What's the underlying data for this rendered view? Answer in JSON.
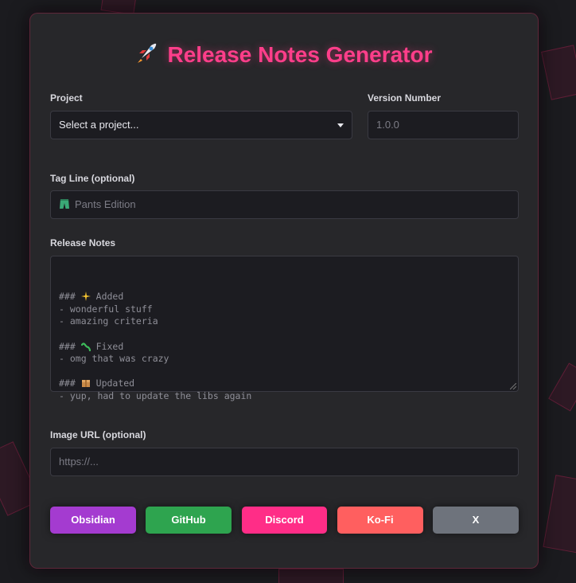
{
  "app": {
    "title": "Release Notes Generator",
    "accent_color": "#ff3e8a",
    "title_icon": "rocket-icon"
  },
  "form": {
    "project": {
      "label": "Project",
      "selected": "Select a project..."
    },
    "version": {
      "label": "Version Number",
      "placeholder": "1.0.0"
    },
    "tagline": {
      "label": "Tag Line (optional)",
      "placeholder_icon": "pants-icon",
      "placeholder": "Pants Edition"
    },
    "release_notes": {
      "label": "Release Notes",
      "lines": [
        {
          "prefix": "### ",
          "icon": "sparkles-icon",
          "text": "Added"
        },
        {
          "prefix": "",
          "icon": null,
          "text": "- wonderful stuff"
        },
        {
          "prefix": "",
          "icon": null,
          "text": "- amazing criteria"
        },
        {
          "prefix": "",
          "icon": null,
          "text": ""
        },
        {
          "prefix": "### ",
          "icon": "worm-icon",
          "text": "Fixed"
        },
        {
          "prefix": "",
          "icon": null,
          "text": "- omg that was crazy"
        },
        {
          "prefix": "",
          "icon": null,
          "text": ""
        },
        {
          "prefix": "### ",
          "icon": "package-icon",
          "text": "Updated"
        },
        {
          "prefix": "",
          "icon": null,
          "text": "- yup, had to update the libs again"
        }
      ]
    },
    "image_url": {
      "label": "Image URL (optional)",
      "placeholder": "https://..."
    }
  },
  "buttons": [
    {
      "label": "Obsidian",
      "color": "#a43bd0"
    },
    {
      "label": "GitHub",
      "color": "#2ea44f"
    },
    {
      "label": "Discord",
      "color": "#ff2d87"
    },
    {
      "label": "Ko-Fi",
      "color": "#ff5f5f"
    },
    {
      "label": "X",
      "color": "#6e737c"
    }
  ]
}
